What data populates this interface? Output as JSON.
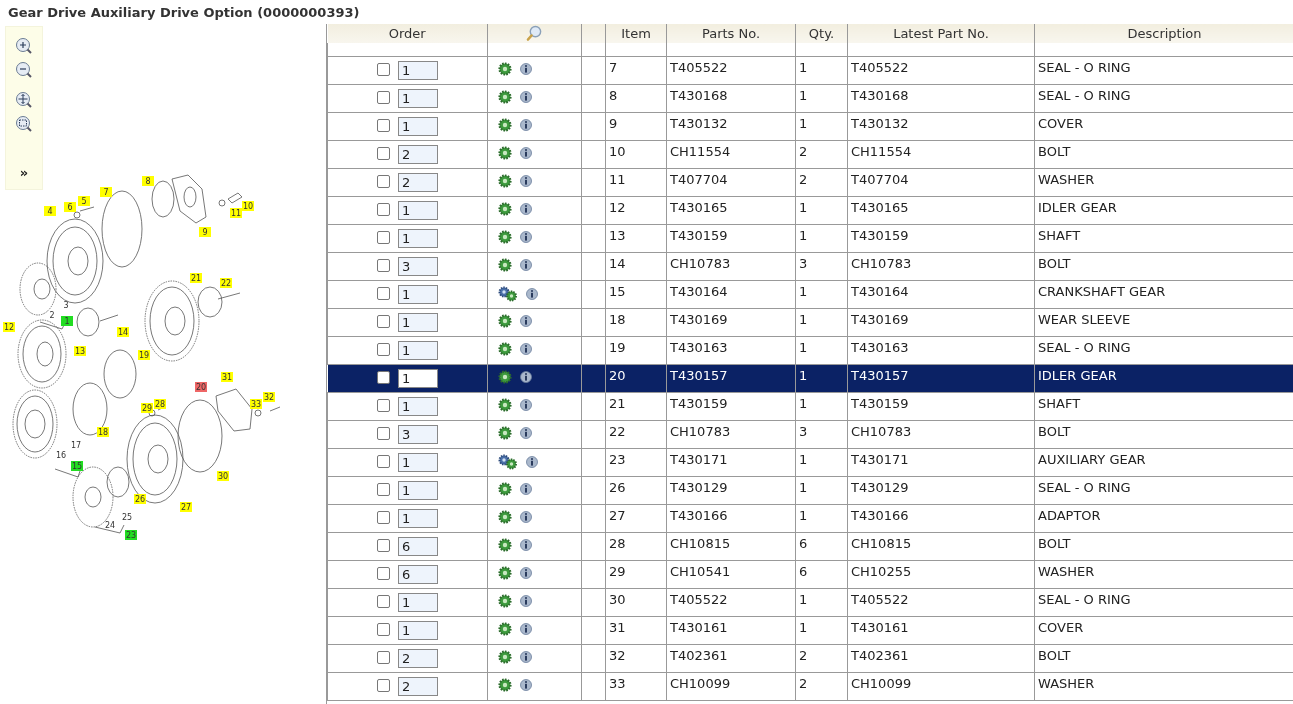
{
  "title": "Gear Drive Auxiliary Drive Option (0000000393)",
  "toolbar": {
    "expand_label": "»"
  },
  "diagram": {
    "callouts": [
      {
        "label": "8",
        "color": "#ffff00"
      },
      {
        "label": "7",
        "color": "#ffff00"
      },
      {
        "label": "5",
        "color": "#ffff00"
      },
      {
        "label": "6",
        "color": "#ffff00"
      },
      {
        "label": "4",
        "color": "#ffff00"
      },
      {
        "label": "10",
        "color": "#ffff00"
      },
      {
        "label": "11",
        "color": "#ffff00"
      },
      {
        "label": "9",
        "color": "#ffff00"
      },
      {
        "label": "21",
        "color": "#ffff00"
      },
      {
        "label": "22",
        "color": "#ffff00"
      },
      {
        "label": "3"
      },
      {
        "label": "2"
      },
      {
        "label": "1",
        "color": "#22dd22"
      },
      {
        "label": "12",
        "color": "#ffff00"
      },
      {
        "label": "14",
        "color": "#ffff00"
      },
      {
        "label": "13",
        "color": "#ffff00"
      },
      {
        "label": "19",
        "color": "#ffff00"
      },
      {
        "label": "20",
        "color": "#ee6666"
      },
      {
        "label": "31",
        "color": "#ffff00"
      },
      {
        "label": "18",
        "color": "#ffff00"
      },
      {
        "label": "29",
        "color": "#ffff00"
      },
      {
        "label": "28",
        "color": "#ffff00"
      },
      {
        "label": "33",
        "color": "#ffff00"
      },
      {
        "label": "32",
        "color": "#ffff00"
      },
      {
        "label": "17"
      },
      {
        "label": "16"
      },
      {
        "label": "15",
        "color": "#22dd22"
      },
      {
        "label": "30",
        "color": "#ffff00"
      },
      {
        "label": "26",
        "color": "#ffff00"
      },
      {
        "label": "27",
        "color": "#ffff00"
      },
      {
        "label": "25"
      },
      {
        "label": "24"
      },
      {
        "label": "23",
        "color": "#22dd22"
      }
    ]
  },
  "table": {
    "columns": [
      "Order",
      "Item",
      "Parts No.",
      "Qty.",
      "Latest Part No.",
      "Description"
    ],
    "rows": [
      {
        "checked": false,
        "order_qty": "1",
        "kind": "single",
        "item": "7",
        "part": "T405522",
        "qty": "1",
        "latest": "T405522",
        "description": "SEAL - O RING",
        "selected": false
      },
      {
        "checked": false,
        "order_qty": "1",
        "kind": "single",
        "item": "8",
        "part": "T430168",
        "qty": "1",
        "latest": "T430168",
        "description": "SEAL - O RING",
        "selected": false
      },
      {
        "checked": false,
        "order_qty": "1",
        "kind": "single",
        "item": "9",
        "part": "T430132",
        "qty": "1",
        "latest": "T430132",
        "description": "COVER",
        "selected": false
      },
      {
        "checked": false,
        "order_qty": "2",
        "kind": "single",
        "item": "10",
        "part": "CH11554",
        "qty": "2",
        "latest": "CH11554",
        "description": "BOLT",
        "selected": false
      },
      {
        "checked": false,
        "order_qty": "2",
        "kind": "single",
        "item": "11",
        "part": "T407704",
        "qty": "2",
        "latest": "T407704",
        "description": "WASHER",
        "selected": false
      },
      {
        "checked": false,
        "order_qty": "1",
        "kind": "single",
        "item": "12",
        "part": "T430165",
        "qty": "1",
        "latest": "T430165",
        "description": "IDLER GEAR",
        "selected": false
      },
      {
        "checked": false,
        "order_qty": "1",
        "kind": "single",
        "item": "13",
        "part": "T430159",
        "qty": "1",
        "latest": "T430159",
        "description": "SHAFT",
        "selected": false
      },
      {
        "checked": false,
        "order_qty": "3",
        "kind": "single",
        "item": "14",
        "part": "CH10783",
        "qty": "3",
        "latest": "CH10783",
        "description": "BOLT",
        "selected": false
      },
      {
        "checked": false,
        "order_qty": "1",
        "kind": "double",
        "item": "15",
        "part": "T430164",
        "qty": "1",
        "latest": "T430164",
        "description": "CRANKSHAFT GEAR",
        "selected": false
      },
      {
        "checked": false,
        "order_qty": "1",
        "kind": "single",
        "item": "18",
        "part": "T430169",
        "qty": "1",
        "latest": "T430169",
        "description": "WEAR SLEEVE",
        "selected": false
      },
      {
        "checked": false,
        "order_qty": "1",
        "kind": "single",
        "item": "19",
        "part": "T430163",
        "qty": "1",
        "latest": "T430163",
        "description": "SEAL - O RING",
        "selected": false
      },
      {
        "checked": false,
        "order_qty": "1",
        "kind": "single",
        "item": "20",
        "part": "T430157",
        "qty": "1",
        "latest": "T430157",
        "description": "IDLER GEAR",
        "selected": true
      },
      {
        "checked": false,
        "order_qty": "1",
        "kind": "single",
        "item": "21",
        "part": "T430159",
        "qty": "1",
        "latest": "T430159",
        "description": "SHAFT",
        "selected": false
      },
      {
        "checked": false,
        "order_qty": "3",
        "kind": "single",
        "item": "22",
        "part": "CH10783",
        "qty": "3",
        "latest": "CH10783",
        "description": "BOLT",
        "selected": false
      },
      {
        "checked": false,
        "order_qty": "1",
        "kind": "double",
        "item": "23",
        "part": "T430171",
        "qty": "1",
        "latest": "T430171",
        "description": "AUXILIARY GEAR",
        "selected": false
      },
      {
        "checked": false,
        "order_qty": "1",
        "kind": "single",
        "item": "26",
        "part": "T430129",
        "qty": "1",
        "latest": "T430129",
        "description": "SEAL - O RING",
        "selected": false
      },
      {
        "checked": false,
        "order_qty": "1",
        "kind": "single",
        "item": "27",
        "part": "T430166",
        "qty": "1",
        "latest": "T430166",
        "description": "ADAPTOR",
        "selected": false
      },
      {
        "checked": false,
        "order_qty": "6",
        "kind": "single",
        "item": "28",
        "part": "CH10815",
        "qty": "6",
        "latest": "CH10815",
        "description": "BOLT",
        "selected": false
      },
      {
        "checked": false,
        "order_qty": "6",
        "kind": "single",
        "item": "29",
        "part": "CH10541",
        "qty": "6",
        "latest": "CH10255",
        "description": "WASHER",
        "selected": false
      },
      {
        "checked": false,
        "order_qty": "1",
        "kind": "single",
        "item": "30",
        "part": "T405522",
        "qty": "1",
        "latest": "T405522",
        "description": "SEAL - O RING",
        "selected": false
      },
      {
        "checked": false,
        "order_qty": "1",
        "kind": "single",
        "item": "31",
        "part": "T430161",
        "qty": "1",
        "latest": "T430161",
        "description": "COVER",
        "selected": false
      },
      {
        "checked": false,
        "order_qty": "2",
        "kind": "single",
        "item": "32",
        "part": "T402361",
        "qty": "2",
        "latest": "T402361",
        "description": "BOLT",
        "selected": false
      },
      {
        "checked": false,
        "order_qty": "2",
        "kind": "single",
        "item": "33",
        "part": "CH10099",
        "qty": "2",
        "latest": "CH10099",
        "description": "WASHER",
        "selected": false
      }
    ]
  }
}
